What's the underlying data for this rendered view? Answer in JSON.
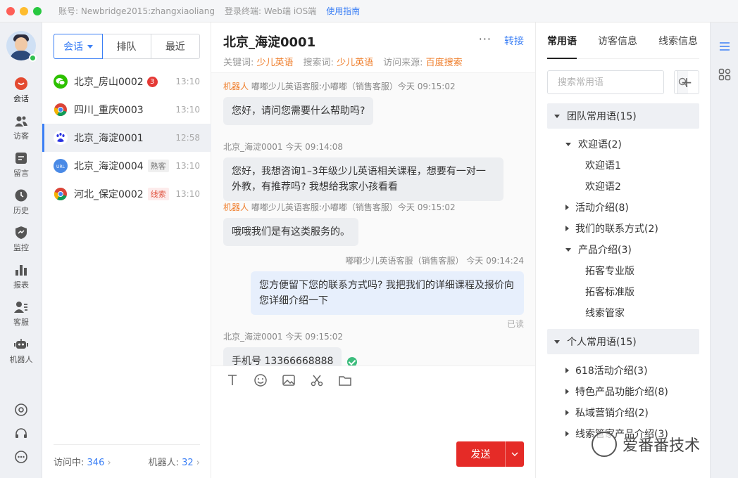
{
  "titlebar": {
    "account": "账号: Newbridge2015:zhangxiaoliang",
    "terminal": "登录终端: Web端 iOS端",
    "guide": "使用指南"
  },
  "rail": {
    "items": [
      {
        "label": "会话",
        "icon": "chat-icon"
      },
      {
        "label": "访客",
        "icon": "visitors-icon"
      },
      {
        "label": "留言",
        "icon": "message-icon"
      },
      {
        "label": "历史",
        "icon": "history-icon"
      },
      {
        "label": "监控",
        "icon": "monitor-icon"
      },
      {
        "label": "报表",
        "icon": "report-icon"
      },
      {
        "label": "客服",
        "icon": "agent-icon"
      },
      {
        "label": "机器人",
        "icon": "robot-icon"
      }
    ],
    "bottom_icons": [
      "settings-icon",
      "headset-icon",
      "more-icon"
    ]
  },
  "list": {
    "segments": [
      "会话",
      "排队",
      "最近"
    ],
    "sessions": [
      {
        "name": "北京_房山0002",
        "badge": "3",
        "tag": "",
        "time": "13:10",
        "channel": "wechat"
      },
      {
        "name": "四川_重庆0003",
        "badge": "",
        "tag": "",
        "time": "13:10",
        "channel": "chrome"
      },
      {
        "name": "北京_海淀0001",
        "badge": "",
        "tag": "",
        "time": "12:58",
        "channel": "baidu"
      },
      {
        "name": "北京_海淀0004",
        "badge": "",
        "tag": "熟客",
        "time": "13:10",
        "channel": "url"
      },
      {
        "name": "河北_保定0002",
        "badge": "",
        "tag": "线索",
        "time": "13:10",
        "channel": "chrome"
      }
    ],
    "footer": {
      "visiting_label": "访问中:",
      "visiting_count": "346",
      "robot_label": "机器人:",
      "robot_count": "32"
    }
  },
  "chat": {
    "title": "北京_海淀0001",
    "more": "···",
    "transfer": "转接",
    "meta": {
      "keyword_label": "关键词:",
      "keyword": "少儿英语",
      "search_label": "搜索词:",
      "search": "少儿英语",
      "source_label": "访问来源:",
      "source": "百度搜索"
    },
    "messages": [
      {
        "side": "left",
        "robot": "机器人",
        "sender": "嘟嘟少儿英语客服:小嘟嘟（销售客服）今天 09:15:02",
        "text": "您好，请问您需要什么帮助吗?"
      },
      {
        "side": "left",
        "robot": "",
        "sender": "北京_海淀0001 今天 09:14:08",
        "text": "您好，我想咨询1–3年级少儿英语相关课程，想要有一对一外教，有推荐吗? 我想给我家小孩看看"
      },
      {
        "side": "left",
        "robot": "机器人",
        "sender": "嘟嘟少儿英语客服:小嘟嘟（销售客服）今天 09:15:02",
        "text": "哦哦我们是有这类服务的。"
      },
      {
        "side": "right",
        "robot": "",
        "sender": "嘟嘟少儿英语客服（销售客服） 今天 09:14:24",
        "text": "您方便留下您的联系方式吗? 我把我们的详细课程及报价向您详细介绍一下",
        "status": "已读"
      },
      {
        "side": "left",
        "robot": "",
        "sender": "北京_海淀0001 今天 09:15:02",
        "text": "手机号 13366668888"
      }
    ],
    "tools": [
      "text-icon",
      "emoji-icon",
      "image-icon",
      "scissors-icon",
      "folder-icon"
    ],
    "send": "发送"
  },
  "rpanel": {
    "tabs": [
      "常用语",
      "访客信息",
      "线索信息"
    ],
    "search_placeholder": "搜索常用语",
    "add": "+",
    "tree": [
      {
        "label": "团队常用语(15)",
        "level": 0,
        "state": "open",
        "group": true
      },
      {
        "label": "欢迎语(2)",
        "level": 1,
        "state": "open"
      },
      {
        "label": "欢迎语1",
        "level": 2,
        "state": "leaf"
      },
      {
        "label": "欢迎语2",
        "level": 2,
        "state": "leaf"
      },
      {
        "label": "活动介绍(8)",
        "level": 1,
        "state": "closed"
      },
      {
        "label": "我们的联系方式(2)",
        "level": 1,
        "state": "closed"
      },
      {
        "label": "产品介绍(3)",
        "level": 1,
        "state": "open"
      },
      {
        "label": "拓客专业版",
        "level": 2,
        "state": "leaf"
      },
      {
        "label": "拓客标准版",
        "level": 2,
        "state": "leaf"
      },
      {
        "label": "线索管家",
        "level": 2,
        "state": "leaf"
      },
      {
        "label": "个人常用语(15)",
        "level": 0,
        "state": "open",
        "group": true
      },
      {
        "label": "618活动介绍(3)",
        "level": 1,
        "state": "closed"
      },
      {
        "label": "特色产品功能介绍(8)",
        "level": 1,
        "state": "closed"
      },
      {
        "label": "私域营销介绍(2)",
        "level": 1,
        "state": "closed"
      },
      {
        "label": "线索管家产品介绍(3)",
        "level": 1,
        "state": "closed"
      }
    ]
  },
  "strip": {
    "icons": [
      "list-icon",
      "apps-icon"
    ]
  },
  "watermark": "爱番番技术",
  "colors": {
    "accent": "#3b7ff5",
    "send": "#e52b27",
    "highlight": "#ef7d2a"
  }
}
